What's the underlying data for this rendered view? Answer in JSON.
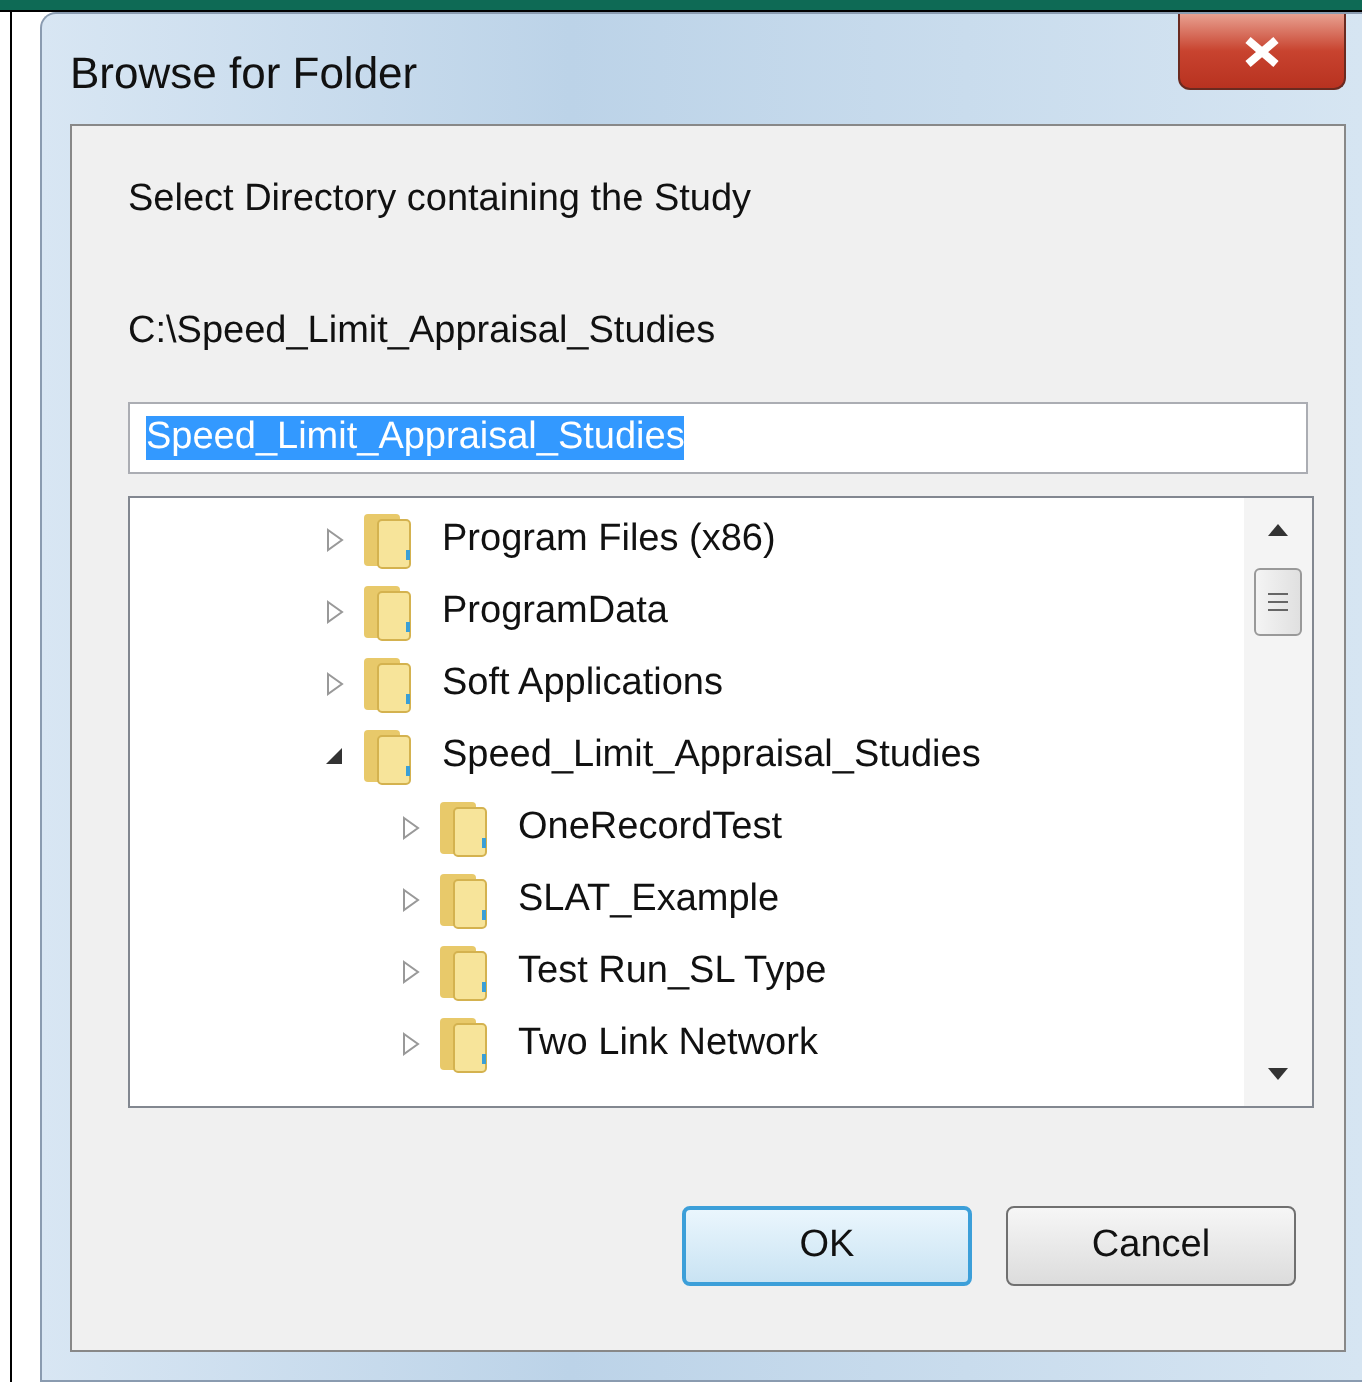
{
  "window": {
    "title": "Browse for Folder"
  },
  "instruction": "Select Directory containing the Study",
  "current_path": "C:\\Speed_Limit_Appraisal_Studies",
  "folder_field": {
    "value": "Speed_Limit_Appraisal_Studies",
    "highlighted": true
  },
  "tree": [
    {
      "label": "Program Files (x86)",
      "expanded": false
    },
    {
      "label": "ProgramData",
      "expanded": false
    },
    {
      "label": "Soft Applications",
      "expanded": false
    },
    {
      "label": "Speed_Limit_Appraisal_Studies",
      "expanded": true,
      "children": [
        {
          "label": "OneRecordTest",
          "expanded": false
        },
        {
          "label": "SLAT_Example",
          "expanded": false
        },
        {
          "label": "Test Run_SL Type",
          "expanded": false
        },
        {
          "label": "Two Link Network",
          "expanded": false
        }
      ]
    }
  ],
  "buttons": [
    {
      "label": "OK",
      "default": true
    },
    {
      "label": "Cancel",
      "default": false
    }
  ]
}
